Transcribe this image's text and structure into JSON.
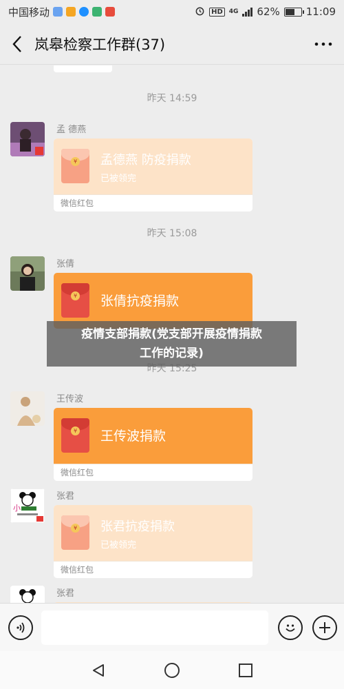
{
  "status_bar": {
    "carrier": "中国移动",
    "network": "4G",
    "battery": "62%",
    "battery_level": 0.62,
    "time": "11:09"
  },
  "header": {
    "title": "岚皋检察工作群(37)"
  },
  "chat": {
    "messages": [
      {
        "timestamp": "昨天 14:59",
        "sender": "孟 德燕",
        "title": "孟德燕 防疫捐款",
        "status": "已被领完",
        "footer": "微信红包",
        "state": "opened"
      },
      {
        "timestamp": "昨天 15:08",
        "sender": "张倩",
        "title": "张倩抗疫捐款",
        "status": "",
        "footer": "",
        "state": "fresh"
      },
      {
        "timestamp": "昨天 15:25",
        "sender": "王传波",
        "title": "王传波捐款",
        "status": "",
        "footer": "微信红包",
        "state": "fresh"
      },
      {
        "timestamp": "",
        "sender": "张君",
        "title": "张君抗疫捐款",
        "status": "已被领完",
        "footer": "微信红包",
        "state": "opened"
      },
      {
        "timestamp": "",
        "sender": "张君",
        "title": "",
        "status": "",
        "footer": "",
        "state": "partial"
      }
    ]
  },
  "banner": {
    "line1": "疫情支部捐款(党支部开展疫情捐款",
    "line2": "工作的记录)"
  },
  "input": {
    "placeholder": "",
    "value": ""
  },
  "colors": {
    "background": "#ededed",
    "red_packet_fresh": "#fa9d3b",
    "red_packet_opened": "#fde3c8",
    "envelope_red": "#e64f45"
  },
  "icons": {
    "back": "chevron-left-icon",
    "more": "more-dots-icon",
    "voice": "voice-icon",
    "emoji": "emoji-icon",
    "plus": "plus-icon",
    "nav_back": "triangle-back-icon",
    "nav_home": "circle-home-icon",
    "nav_recent": "square-recent-icon"
  }
}
